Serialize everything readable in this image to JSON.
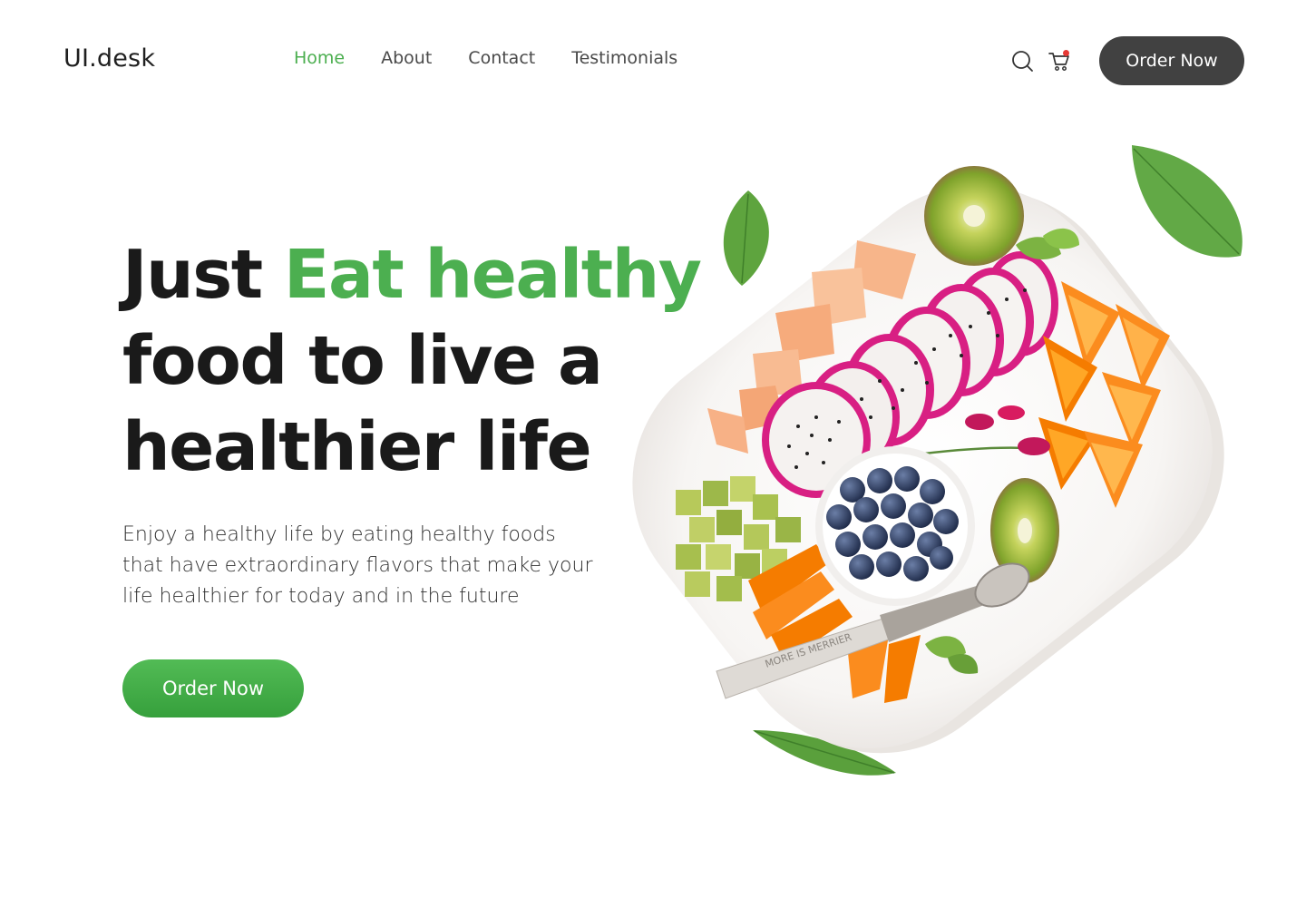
{
  "header": {
    "logo": "UI.desk",
    "nav": [
      {
        "label": "Home",
        "active": true
      },
      {
        "label": "About",
        "active": false
      },
      {
        "label": "Contact",
        "active": false
      },
      {
        "label": "Testimonials",
        "active": false
      }
    ],
    "icons": [
      "search-icon",
      "cart-icon"
    ],
    "order_button": "Order Now"
  },
  "hero": {
    "headline": {
      "part1": "Just ",
      "highlight": "Eat healthy",
      "line2": "food to live a",
      "line3": "healthier life"
    },
    "description": "Enjoy a healthy life by eating healthy foods that have extraordinary flavors that make your life healthier for today and in the future",
    "cta": "Order Now",
    "spoon_text": "MORE IS MERRIER"
  },
  "colors": {
    "accent": "#4caf50",
    "dark_button": "#414141",
    "notification_dot": "#e53935"
  }
}
